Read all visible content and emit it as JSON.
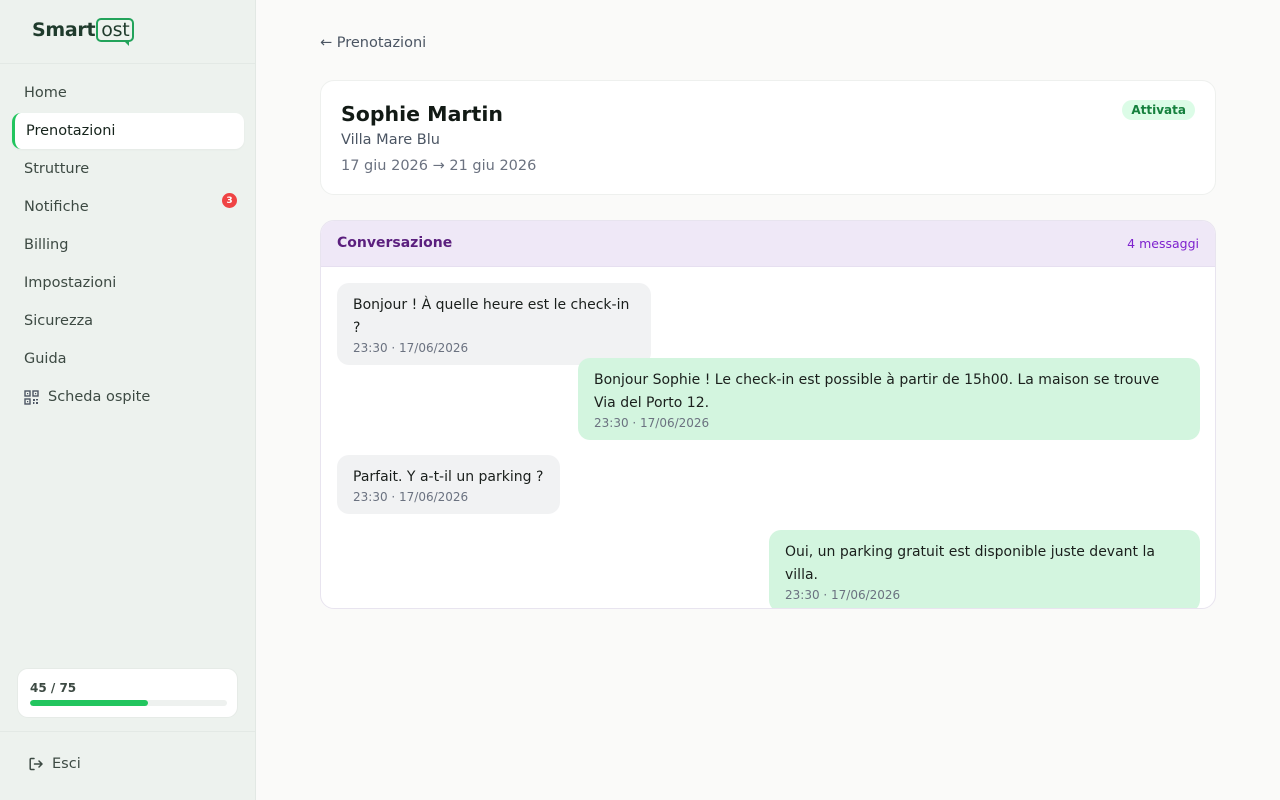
{
  "app": {
    "logo_prefix": "Smart",
    "logo_box": "ost"
  },
  "sidebar": {
    "items": [
      {
        "label": "Home"
      },
      {
        "label": "Prenotazioni",
        "active": true
      },
      {
        "label": "Strutture"
      },
      {
        "label": "Notifiche",
        "badge": "3"
      },
      {
        "label": "Billing"
      },
      {
        "label": "Impostazioni"
      },
      {
        "label": "Sicurezza"
      },
      {
        "label": "Guida"
      },
      {
        "label": "Scheda ospite",
        "icon": "qr-code-icon"
      }
    ],
    "quota": {
      "text": "45 / 75",
      "used": 45,
      "total": 75
    },
    "logout_label": "Esci"
  },
  "main": {
    "back_label": "← Prenotazioni",
    "guest": {
      "name": "Sophie Martin",
      "property": "Villa Mare Blu",
      "dates": "17 giu 2026 → 21 giu 2026",
      "status": "Attivata"
    },
    "conversation": {
      "title": "Conversazione",
      "count": "4 messaggi",
      "messages": [
        {
          "direction": "in",
          "text": "Bonjour ! À quelle heure est le check-in ?",
          "time": "23:30 · 17/06/2026"
        },
        {
          "direction": "out",
          "text": "Bonjour Sophie ! Le check-in est possible à partir de 15h00. La maison se trouve Via del Porto 12.",
          "time": "23:30 · 17/06/2026"
        },
        {
          "direction": "in",
          "text": "Parfait. Y a-t-il un parking ?",
          "time": "23:30 · 17/06/2026"
        },
        {
          "direction": "out",
          "text": "Oui, un parking gratuit est disponible juste devant la villa.",
          "time": "23:30 · 17/06/2026"
        }
      ]
    }
  },
  "colors": {
    "accent": "#22c55e",
    "status_bg": "#dcfce7",
    "status_text": "#15803d",
    "conversation_header_bg": "#efe8f7",
    "conversation_title": "#5b1f7e",
    "badge": "#ef4444",
    "outgoing_bubble": "#d3f5df",
    "incoming_bubble": "#f1f2f3"
  }
}
